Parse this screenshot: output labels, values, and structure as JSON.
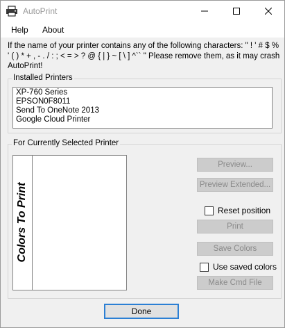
{
  "window": {
    "title": "AutoPrint"
  },
  "menu": {
    "items": [
      "Help",
      "About"
    ]
  },
  "warning": {
    "text": "If the name of your printer contains any of the following characters: \" ! ' # $ %  ' ( ) * + , - . / : ; < = > ? @ { | } ~ [ \\ ] ^`` \" Please remove them, as it may crash AutoPrint!"
  },
  "installed_printers": {
    "label": "Installed Printers",
    "items": [
      "XP-760 Series",
      "EPSON0F8011",
      "Send To OneNote 2013",
      "Google Cloud Printer"
    ]
  },
  "selected_printer": {
    "label": "For Currently Selected Printer",
    "colors_label": "Colors To Print",
    "buttons": {
      "preview": "Preview...",
      "preview_extended": "Preview Extended...",
      "print": "Print",
      "save_colors": "Save Colors",
      "make_cmd_file": "Make Cmd File"
    },
    "checkboxes": {
      "reset_position": "Reset position",
      "use_saved_colors": "Use saved colors"
    }
  },
  "done_button": "Done",
  "icons": [
    "printer-icon",
    "minimize-icon",
    "maximize-icon",
    "close-icon"
  ]
}
